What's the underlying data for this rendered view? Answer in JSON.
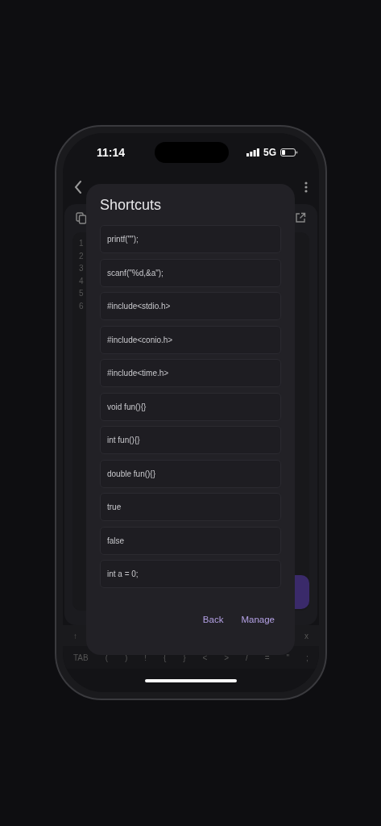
{
  "status_bar": {
    "time": "11:14",
    "network": "5G"
  },
  "editor": {
    "line_numbers": [
      "1",
      "2",
      "3",
      "4",
      "5",
      "6"
    ]
  },
  "keyboard": {
    "top_row": [
      "↑",
      "x"
    ],
    "symbol_row": [
      "TAB",
      "(",
      ")",
      "!",
      "{",
      "}",
      "<",
      ">",
      "/",
      "=",
      "\"",
      ";"
    ]
  },
  "dialog": {
    "title": "Shortcuts",
    "shortcuts": [
      "printf(\"\");",
      "scanf(\"%d,&a\");",
      "#include<stdio.h>",
      "#include<conio.h>",
      "#include<time.h>",
      "void fun(){}",
      "int fun(){}",
      "double fun(){}",
      "true",
      "false",
      "int a = 0;"
    ],
    "buttons": [
      "Back",
      "Manage"
    ]
  }
}
